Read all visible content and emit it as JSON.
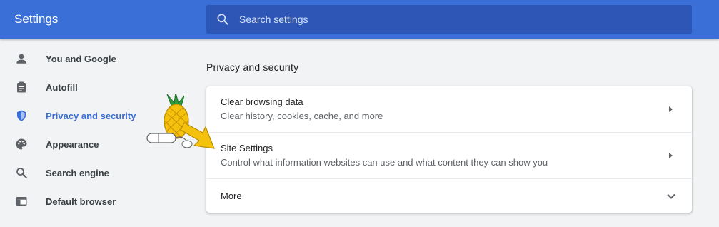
{
  "header": {
    "title": "Settings",
    "search_placeholder": "Search settings"
  },
  "sidebar": {
    "items": [
      {
        "label": "You and Google",
        "icon": "person-icon",
        "active": false
      },
      {
        "label": "Autofill",
        "icon": "clipboard-icon",
        "active": false
      },
      {
        "label": "Privacy and security",
        "icon": "shield-icon",
        "active": true
      },
      {
        "label": "Appearance",
        "icon": "palette-icon",
        "active": false
      },
      {
        "label": "Search engine",
        "icon": "magnifier-icon",
        "active": false
      },
      {
        "label": "Default browser",
        "icon": "browser-window-icon",
        "active": false
      }
    ]
  },
  "main": {
    "section_title": "Privacy and security",
    "rows": [
      {
        "title": "Clear browsing data",
        "subtitle": "Clear history, cookies, cache, and more",
        "icon": "arrow-right-icon"
      },
      {
        "title": "Site Settings",
        "subtitle": "Control what information websites can use and what content they can show you",
        "icon": "arrow-right-icon"
      },
      {
        "title": "More",
        "icon": "chevron-down-icon"
      }
    ]
  },
  "colors": {
    "header": "#3a6fd8",
    "search_box": "#2d56b6",
    "accent": "#3a6fd8",
    "background": "#f1f3f4",
    "card": "#ffffff",
    "pointer_arrow": "#f4c20d"
  }
}
